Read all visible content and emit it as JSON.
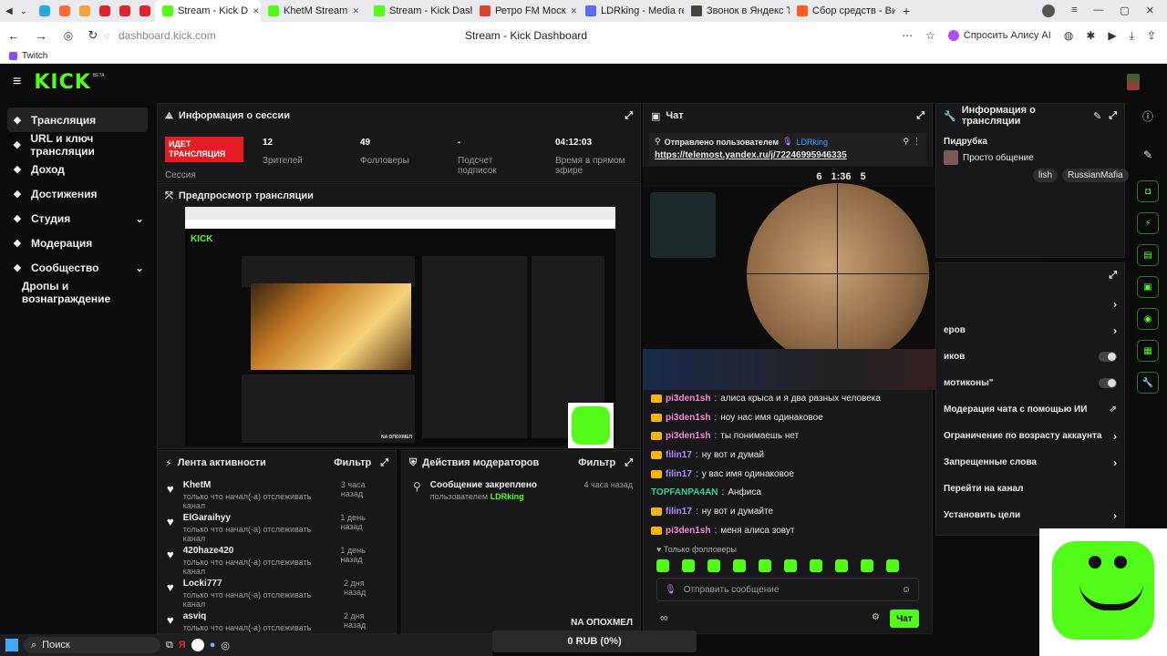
{
  "browser": {
    "tabs": [
      {
        "label": "Stream - Kick D",
        "color": "#53fc18",
        "active": true
      },
      {
        "label": "KhetM Stream",
        "color": "#53fc18"
      },
      {
        "label": "Stream - Kick Dashbo",
        "color": "#53fc18"
      },
      {
        "label": "Ретро FM Моск",
        "color": "#e0442e"
      },
      {
        "label": "LDRking - Media requ",
        "color": "#5f6bf0"
      },
      {
        "label": "Звонок в Яндекс Те",
        "color": "#444444"
      },
      {
        "label": "Сбор средств - Видж",
        "color": "#ff5a1f"
      }
    ],
    "url": "dashboard.kick.com",
    "page_title": "Stream - Kick Dashboard",
    "alice_label": "Спросить Алису AI",
    "bookmark": "Twitch"
  },
  "kick": {
    "logo": "KICK",
    "logo_beta": "BETA"
  },
  "sidebar": [
    {
      "label": "Трансляция",
      "icon": "broadcast-icon",
      "active": true
    },
    {
      "label": "URL и ключ трансляции",
      "icon": "key-icon"
    },
    {
      "label": "Доход",
      "icon": "income-icon"
    },
    {
      "label": "Достижения",
      "icon": "trophy-icon"
    },
    {
      "label": "Студия",
      "icon": "studio-icon",
      "chevron": true
    },
    {
      "label": "Модерация",
      "icon": "wrench-icon"
    },
    {
      "label": "Сообщество",
      "icon": "community-icon",
      "chevron": true
    },
    {
      "label": "Дропы и вознаграждение",
      "icon": ""
    }
  ],
  "session": {
    "title": "Информация о сессии",
    "live_badge": "ИДЕТ ТРАНСЛЯЦИЯ",
    "session_label": "Сессия",
    "viewers_value": "12",
    "viewers_label": "Зрителей",
    "followers_value": "49",
    "followers_label": "Фолловеры",
    "subs_value": "-",
    "subs_label": "Подсчет подписок",
    "time_value": "04:12:03",
    "time_label": "Время в прямом эфире"
  },
  "preview": {
    "title": "Предпросмотр трансляции",
    "banner": "NA ОПОХМЕЛ"
  },
  "activity": {
    "title": "Лента активности",
    "filter": "Фильтр",
    "items": [
      {
        "name": "KhetM",
        "sub": "только что начал(-а) отслеживать канал",
        "time": "3 часа назад"
      },
      {
        "name": "ElGaraihyy",
        "sub": "только что начал(-а) отслеживать канал",
        "time": "1 день назад"
      },
      {
        "name": "420haze420",
        "sub": "только что начал(-а) отслеживать канал",
        "time": "1 день назад"
      },
      {
        "name": "Locki777",
        "sub": "только что начал(-а) отслеживать канал",
        "time": "2 дня назад"
      },
      {
        "name": "asviq",
        "sub": "только что начал(-а) отслеживать канал",
        "time": "2 дня назад"
      }
    ]
  },
  "mod_actions": {
    "title": "Действия модераторов",
    "filter": "Фильтр",
    "item_title": "Сообщение закреплено",
    "item_by": "пользователем",
    "item_user": "LDRking",
    "item_time": "4 часа назад",
    "footer": "NA ОПОХМЕЛ"
  },
  "chat": {
    "title": "Чат",
    "pinned_label": "Отправлено пользователем",
    "pinned_user": "LDRking",
    "pinned_link": "https://telemost.yandex.ru/j/72246995946335",
    "messages": [
      {
        "user": "pi3den1sh",
        "text": "алиса крыса и я два разных человека",
        "ucolor": "#f08ad6",
        "crown": true
      },
      {
        "user": "pi3den1sh",
        "text": "ноу нас имя одинаковое",
        "ucolor": "#f08ad6",
        "crown": true
      },
      {
        "user": "pi3den1sh",
        "text": "ты понимаешь нет",
        "ucolor": "#f08ad6",
        "crown": true
      },
      {
        "user": "filin17",
        "text": "ну вот и думай",
        "ucolor": "#b58cff",
        "crown": true
      },
      {
        "user": "filin17",
        "text": "у вас имя одинаковое",
        "ucolor": "#b58cff",
        "crown": true
      },
      {
        "user": "TOPFANPA4AN",
        "text": "Анфиса",
        "ucolor": "#2ed39a",
        "crown": false
      },
      {
        "user": "filin17",
        "text": "ну вот и думайте",
        "ucolor": "#b58cff",
        "crown": true
      },
      {
        "user": "pi3den1sh",
        "text": "меня алиса зовут",
        "ucolor": "#f08ad6",
        "crown": true
      }
    ],
    "followers_only": "Только фолловеры",
    "placeholder": "Отправить сообщение",
    "send": "Чат"
  },
  "stream_info": {
    "title": "Информация о трансляции",
    "category": "Пидрубка",
    "stream_title": "Просто общение",
    "tags": [
      "lish",
      "RussianMafia"
    ]
  },
  "settings": {
    "rows": [
      {
        "label": "",
        "type": "chevron"
      },
      {
        "label": "еров",
        "type": "chevron"
      },
      {
        "label": "иков",
        "type": "toggle"
      },
      {
        "label": "мотиконы\"",
        "type": "toggle"
      },
      {
        "label": "Модерация чата с помощью ИИ",
        "type": "ext"
      },
      {
        "label": "Ограничение по возрасту аккаунта",
        "type": "chevron"
      },
      {
        "label": "Запрещенные слова",
        "type": "chevron"
      },
      {
        "label": "Перейти на канал",
        "type": "none"
      },
      {
        "label": "Установить цели",
        "type": "chevron"
      }
    ]
  },
  "game": {
    "score_left": "6",
    "score_right": "5",
    "timer": "1:36",
    "ticker": "0 RUB (0%)"
  },
  "taskbar": {
    "search": "Поиск"
  },
  "colors": {
    "accent": "#53fc18",
    "live": "#e51c23"
  }
}
